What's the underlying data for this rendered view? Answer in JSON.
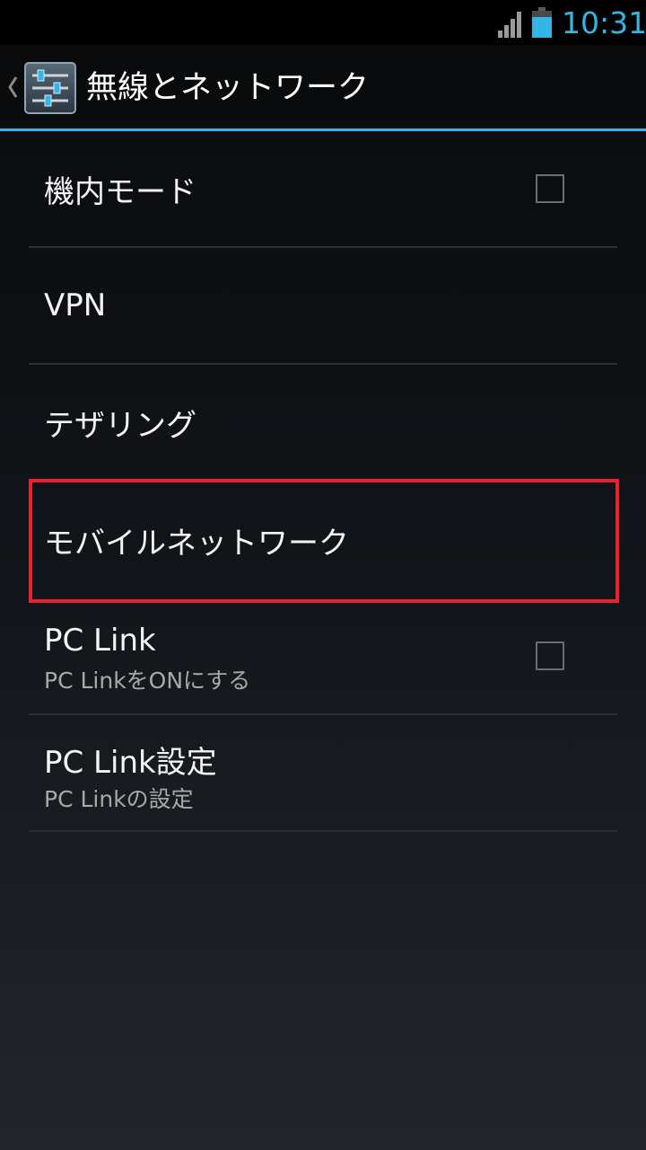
{
  "status_bar": {
    "time": "10:31",
    "signal_icon": "signal-strength-icon",
    "battery_icon": "battery-icon",
    "accent_color": "#33b5e5"
  },
  "action_bar": {
    "up_icon": "chevron-left-icon",
    "app_icon": "settings-sliders-icon",
    "title": "無線とネットワーク"
  },
  "preferences": {
    "airplane_mode": {
      "title": "機内モード",
      "checked": false
    },
    "vpn": {
      "title": "VPN"
    },
    "tethering": {
      "title": "テザリング"
    },
    "mobile_network": {
      "title": "モバイルネットワーク",
      "highlighted": true,
      "highlight_color": "#e8222e"
    },
    "pc_link": {
      "title": "PC Link",
      "summary": "PC LinkをONにする",
      "checked": false
    },
    "pc_link_settings": {
      "title": "PC Link設定",
      "summary": "PC Linkの設定"
    }
  }
}
